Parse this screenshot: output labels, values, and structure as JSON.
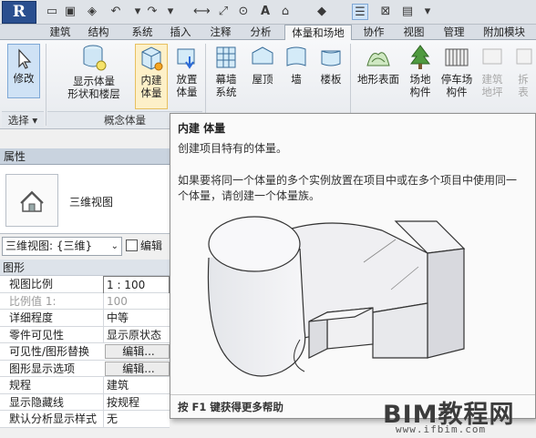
{
  "app": {
    "logo": "R"
  },
  "tabs": [
    "建筑",
    "结构",
    "系统",
    "插入",
    "注释",
    "分析",
    "体量和场地",
    "协作",
    "视图",
    "管理",
    "附加模块"
  ],
  "ribbon": {
    "modify": {
      "label": "修改"
    },
    "select_label": "选择 ▾",
    "show_mass": {
      "line1": "显示体量",
      "line2": "形状和楼层"
    },
    "inplace_mass": {
      "line1": "内建",
      "line2": "体量"
    },
    "place_mass": {
      "line1": "放置",
      "line2": "体量"
    },
    "curtain": {
      "line1": "幕墙",
      "line2": "系统"
    },
    "roof": {
      "label": "屋顶"
    },
    "wall": {
      "label": "墙"
    },
    "floor": {
      "label": "楼板"
    },
    "toposurface": {
      "label": "地形表面"
    },
    "site_comp": {
      "line1": "场地",
      "line2": "构件"
    },
    "parking": {
      "line1": "停车场",
      "line2": "构件"
    },
    "pad": {
      "line1": "建筑",
      "line2": "地坪"
    },
    "split": {
      "line1": "拆",
      "line2": "表"
    },
    "group_concept": "概念体量"
  },
  "properties": {
    "header": "属性",
    "type_name": "三维视图",
    "view_selector": "三维视图: {三维}",
    "edit_type": "编辑",
    "category": "图形",
    "rows": [
      {
        "name": "视图比例",
        "value": "1 : 100",
        "style": "box"
      },
      {
        "name": "比例值 1:",
        "value": "100",
        "style": "gray"
      },
      {
        "name": "详细程度",
        "value": "中等",
        "style": "plain"
      },
      {
        "name": "零件可见性",
        "value": "显示原状态",
        "style": "plain"
      },
      {
        "name": "可见性/图形替换",
        "value": "编辑...",
        "style": "btn"
      },
      {
        "name": "图形显示选项",
        "value": "编辑...",
        "style": "btn"
      },
      {
        "name": "规程",
        "value": "建筑",
        "style": "plain"
      },
      {
        "name": "显示隐藏线",
        "value": "按规程",
        "style": "plain"
      },
      {
        "name": "默认分析显示样式",
        "value": "无",
        "style": "plain"
      }
    ]
  },
  "tooltip": {
    "title": "内建 体量",
    "desc": "创建项目特有的体量。",
    "long": "如果要将同一个体量的多个实例放置在项目中或在多个项目中使用同一个体量，请创建一个体量族。",
    "footer": "按 F1 键获得更多帮助"
  },
  "watermark": {
    "main": "BIM教程网",
    "url": "www.ifbim.com"
  },
  "colors": {
    "accent": "#2a4f8f",
    "pressed": "#cfe2f5",
    "panel_header": "#c9d3df"
  }
}
